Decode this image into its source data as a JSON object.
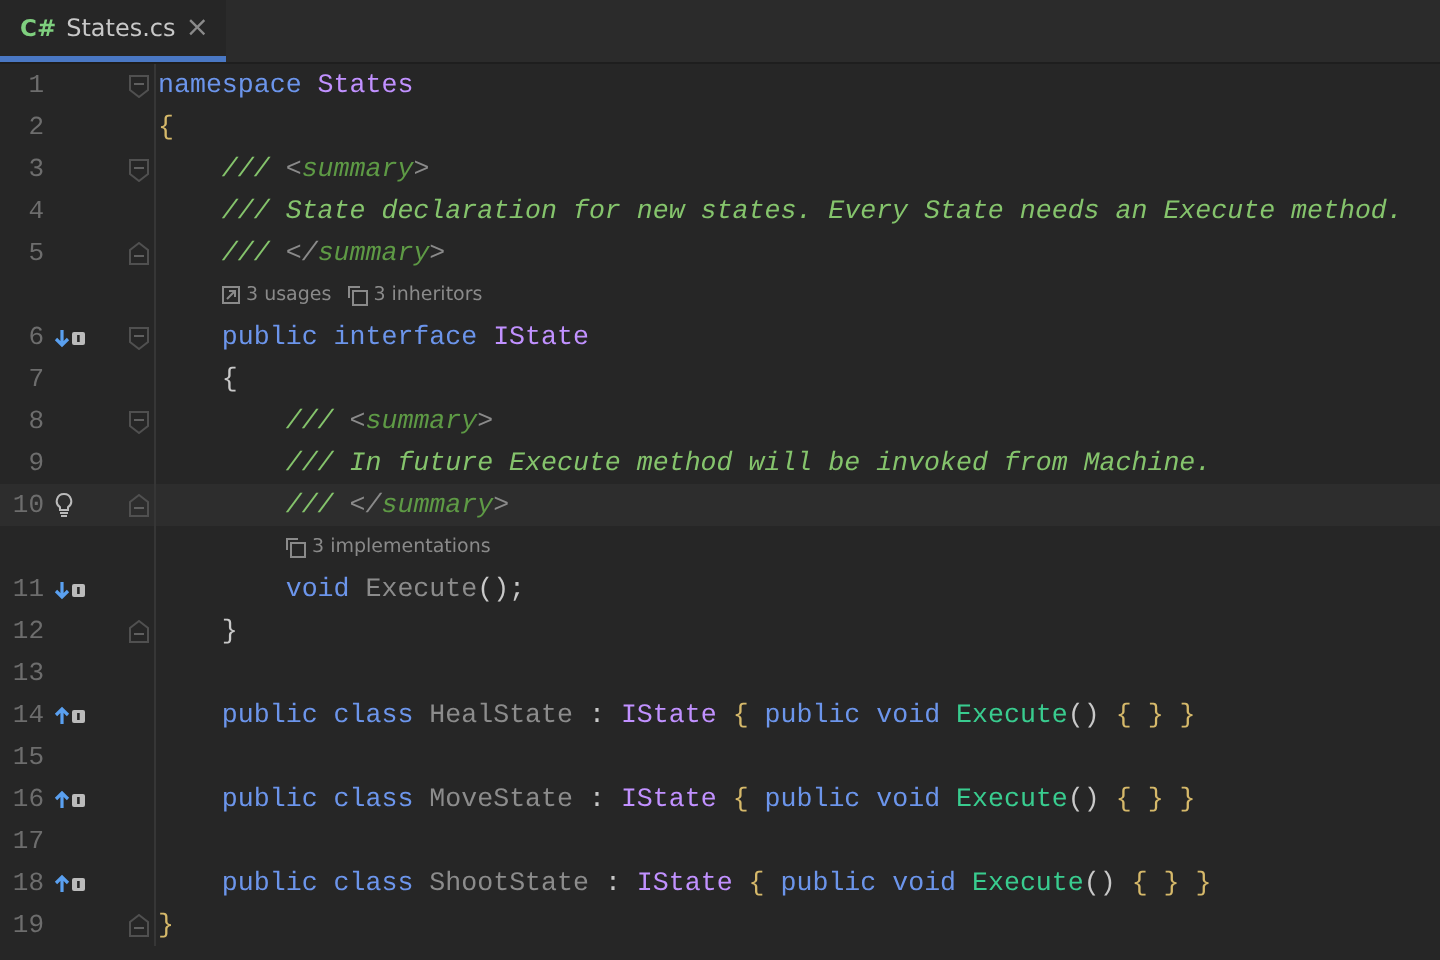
{
  "tabs": [
    {
      "icon_text": "C#",
      "label": "States.cs",
      "close": "×",
      "selected": true
    }
  ],
  "lines": [
    {
      "kind": "code",
      "number": "1",
      "fold": {
        "kind": "start"
      },
      "tokens": [
        {
          "t": "namespace ",
          "kind": "kw"
        },
        {
          "t": "States",
          "kind": "type"
        }
      ]
    },
    {
      "kind": "code",
      "number": "2",
      "tokens": [
        {
          "t": "{",
          "kind": "brace"
        }
      ]
    },
    {
      "kind": "code",
      "number": "3",
      "fold": {
        "kind": "start"
      },
      "tokens": [
        {
          "t": "    /// ",
          "kind": "doc"
        },
        {
          "t": "<",
          "kind": "tag"
        },
        {
          "t": "summary",
          "kind": "tagname"
        },
        {
          "t": ">",
          "kind": "tag"
        }
      ]
    },
    {
      "kind": "code",
      "number": "4",
      "tokens": [
        {
          "t": "    /// State declaration for new states. Every State needs an Execute method.",
          "kind": "doc"
        }
      ]
    },
    {
      "kind": "code",
      "number": "5",
      "fold": {
        "kind": "end"
      },
      "tokens": [
        {
          "t": "    /// ",
          "kind": "doc"
        },
        {
          "t": "</",
          "kind": "tag"
        },
        {
          "t": "summary",
          "kind": "tagname"
        },
        {
          "t": ">",
          "kind": "tag"
        }
      ]
    },
    {
      "kind": "hint",
      "items": [
        {
          "kind": "usages",
          "text": "3 usages"
        },
        {
          "kind": "inheritors",
          "text": "3 inheritors"
        }
      ]
    },
    {
      "kind": "code",
      "number": "6",
      "gutter": {
        "kind": "down"
      },
      "fold": {
        "kind": "start"
      },
      "tokens": [
        {
          "t": "    public ",
          "kind": "kw"
        },
        {
          "t": "interface ",
          "kind": "kw"
        },
        {
          "t": "IState",
          "kind": "type"
        }
      ]
    },
    {
      "kind": "code",
      "number": "7",
      "tokens": [
        {
          "t": "    {",
          "kind": "punct"
        }
      ]
    },
    {
      "kind": "code",
      "number": "8",
      "fold": {
        "kind": "start"
      },
      "tokens": [
        {
          "t": "        /// ",
          "kind": "doc"
        },
        {
          "t": "<",
          "kind": "tag"
        },
        {
          "t": "summary",
          "kind": "tagname"
        },
        {
          "t": ">",
          "kind": "tag"
        }
      ]
    },
    {
      "kind": "code",
      "number": "9",
      "tokens": [
        {
          "t": "        /// In future Execute method will be invoked from Machine.",
          "kind": "doc"
        }
      ]
    },
    {
      "kind": "code",
      "number": "10",
      "gutter": {
        "kind": "bulb"
      },
      "fold": {
        "kind": "end"
      },
      "current": true,
      "tokens": [
        {
          "t": "        /// ",
          "kind": "doc"
        },
        {
          "t": "</",
          "kind": "tag"
        },
        {
          "t": "summary",
          "kind": "tagname"
        },
        {
          "t": ">",
          "kind": "tag"
        }
      ]
    },
    {
      "kind": "hint",
      "items": [
        {
          "kind": "inheritors",
          "text": "3 implementations"
        }
      ]
    },
    {
      "kind": "code",
      "number": "11",
      "gutter": {
        "kind": "down"
      },
      "tokens": [
        {
          "t": "        void ",
          "kind": "kw"
        },
        {
          "t": "Execute",
          "kind": "unused"
        },
        {
          "t": "();",
          "kind": "punct"
        }
      ]
    },
    {
      "kind": "code",
      "number": "12",
      "fold": {
        "kind": "end"
      },
      "tokens": [
        {
          "t": "    }",
          "kind": "punct"
        }
      ]
    },
    {
      "kind": "code",
      "number": "13"
    },
    {
      "kind": "code",
      "number": "14",
      "gutter": {
        "kind": "up"
      },
      "tokens": [
        {
          "t": "    public ",
          "kind": "kw"
        },
        {
          "t": "class ",
          "kind": "kw"
        },
        {
          "t": "HealState",
          "kind": "unused"
        },
        {
          "t": " : ",
          "kind": "punct"
        },
        {
          "t": "IState ",
          "kind": "type"
        },
        {
          "t": "{ ",
          "kind": "brace"
        },
        {
          "t": "public ",
          "kind": "kw"
        },
        {
          "t": "void ",
          "kind": "kw"
        },
        {
          "t": "Execute",
          "kind": "method"
        },
        {
          "t": "() ",
          "kind": "punct"
        },
        {
          "t": "{ } }",
          "kind": "brace"
        }
      ]
    },
    {
      "kind": "code",
      "number": "15"
    },
    {
      "kind": "code",
      "number": "16",
      "gutter": {
        "kind": "up"
      },
      "tokens": [
        {
          "t": "    public ",
          "kind": "kw"
        },
        {
          "t": "class ",
          "kind": "kw"
        },
        {
          "t": "MoveState",
          "kind": "unused"
        },
        {
          "t": " : ",
          "kind": "punct"
        },
        {
          "t": "IState ",
          "kind": "type"
        },
        {
          "t": "{ ",
          "kind": "brace"
        },
        {
          "t": "public ",
          "kind": "kw"
        },
        {
          "t": "void ",
          "kind": "kw"
        },
        {
          "t": "Execute",
          "kind": "method"
        },
        {
          "t": "() ",
          "kind": "punct"
        },
        {
          "t": "{ } }",
          "kind": "brace"
        }
      ]
    },
    {
      "kind": "code",
      "number": "17"
    },
    {
      "kind": "code",
      "number": "18",
      "gutter": {
        "kind": "up"
      },
      "tokens": [
        {
          "t": "    public ",
          "kind": "kw"
        },
        {
          "t": "class ",
          "kind": "kw"
        },
        {
          "t": "ShootState",
          "kind": "unused"
        },
        {
          "t": " : ",
          "kind": "punct"
        },
        {
          "t": "IState ",
          "kind": "type"
        },
        {
          "t": "{ ",
          "kind": "brace"
        },
        {
          "t": "public ",
          "kind": "kw"
        },
        {
          "t": "void ",
          "kind": "kw"
        },
        {
          "t": "Execute",
          "kind": "method"
        },
        {
          "t": "() ",
          "kind": "punct"
        },
        {
          "t": "{ } }",
          "kind": "brace"
        }
      ]
    },
    {
      "kind": "code",
      "number": "19",
      "fold": {
        "kind": "end"
      },
      "tokens": [
        {
          "t": "}",
          "kind": "brace"
        }
      ]
    }
  ]
}
